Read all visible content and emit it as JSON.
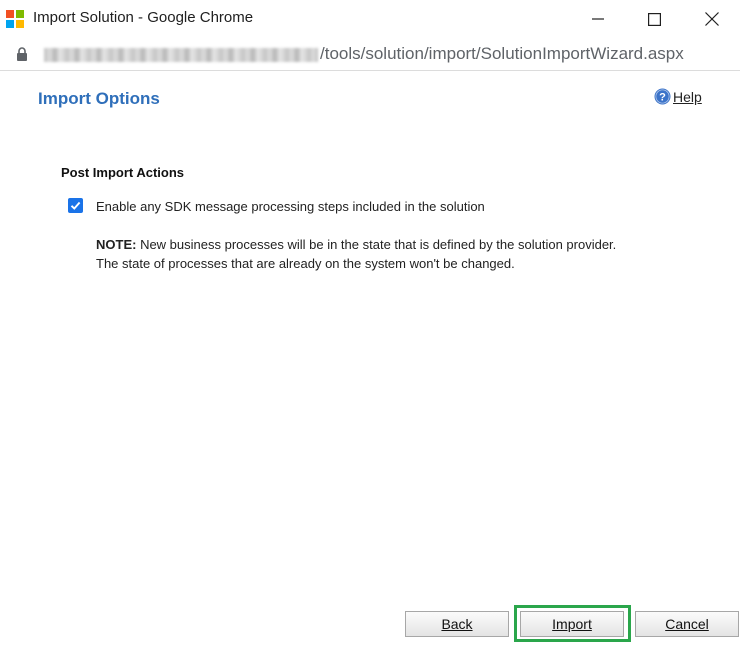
{
  "window": {
    "title": "Import Solution - Google Chrome",
    "controls": [
      "minimize",
      "maximize",
      "close"
    ]
  },
  "address_bar": {
    "url_path": "/tools/solution/import/SolutionImportWizard.aspx"
  },
  "page": {
    "title": "Import Options",
    "help_label": "Help",
    "section_heading": "Post Import Actions",
    "checkbox": {
      "checked": true,
      "label": "Enable any SDK message processing steps included in the solution"
    },
    "note": {
      "prefix": "NOTE:",
      "line1": " New business processes will be in the state that is defined by the solution provider.",
      "line2": "The state of processes that are already on the system won't be changed."
    }
  },
  "buttons": {
    "back": "Back",
    "import": "Import",
    "cancel": "Cancel"
  },
  "colors": {
    "title_blue": "#2f6fba",
    "checkbox_blue": "#1a73e8",
    "highlight_green": "#2aa64b"
  }
}
